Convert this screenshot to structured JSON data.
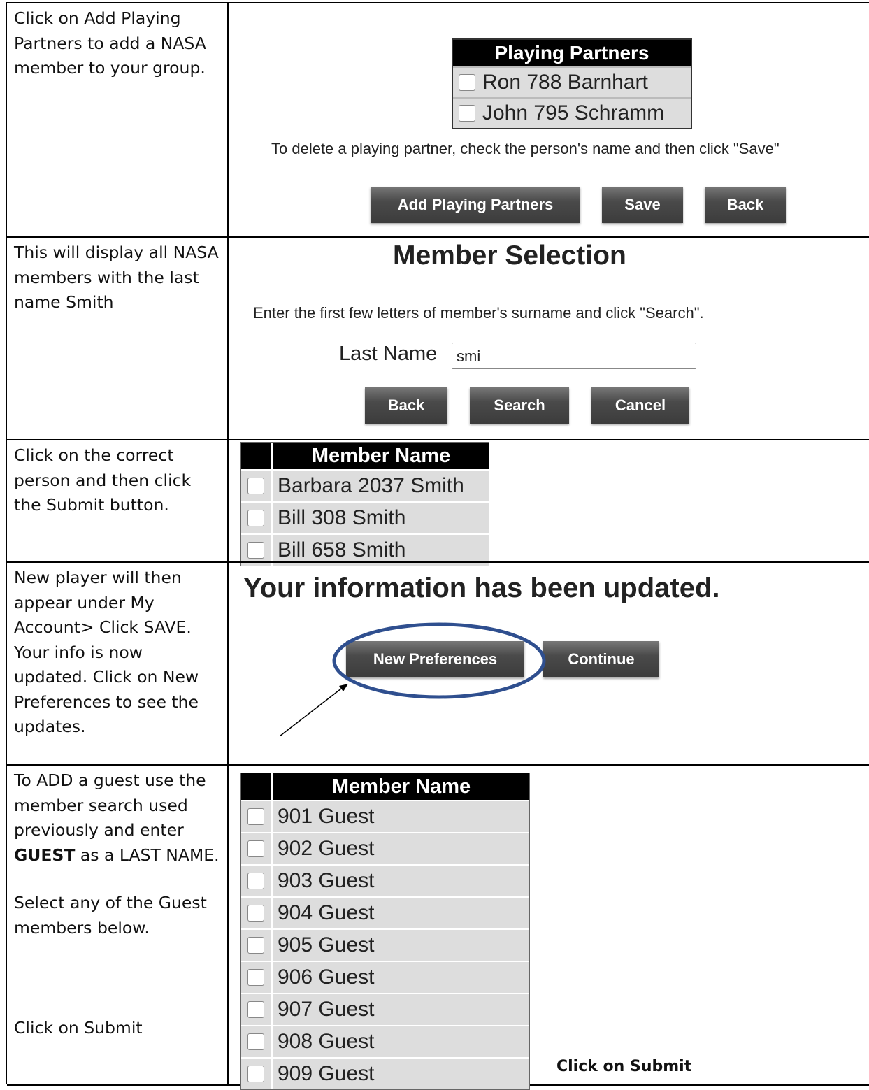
{
  "rows": [
    {
      "instruction": "Click on Add Playing Partners to add a NASA member to your group."
    },
    {
      "instruction": "This will display all NASA members with the last name Smith"
    },
    {
      "instruction": "Click on the correct person and then click the Submit button."
    },
    {
      "instruction": "New player will then appear under My Account> Click SAVE. Your info is now updated.  Click on New Preferences to see the updates."
    },
    {
      "instruction_part1_before": "To ADD a guest use the member search used previously and enter ",
      "instruction_part1_bold": "GUEST",
      "instruction_part1_after": " as a LAST NAME.",
      "instruction_part2": "Select any of the Guest members below.",
      "instruction_part3": "Click on Submit"
    }
  ],
  "playing_partners": {
    "title": "Playing Partners",
    "members": [
      "Ron 788 Barnhart",
      "John 795 Schramm"
    ],
    "delete_hint": "To delete a playing partner, check the person's name and then click \"Save\"",
    "buttons": {
      "add": "Add Playing Partners",
      "save": "Save",
      "back": "Back"
    }
  },
  "member_selection": {
    "title": "Member Selection",
    "hint": "Enter the first few letters of member's surname and click \"Search\".",
    "last_name_label": "Last Name",
    "last_name_value": "smi",
    "buttons": {
      "back": "Back",
      "search": "Search",
      "cancel": "Cancel"
    }
  },
  "smith_results": {
    "header": "Member Name",
    "members": [
      "Barbara 2037 Smith",
      "Bill 308 Smith",
      "Bill 658 Smith"
    ]
  },
  "updated": {
    "message": "Your information has been updated.",
    "buttons": {
      "new_preferences": "New Preferences",
      "continue": "Continue"
    }
  },
  "guest_results": {
    "header": "Member Name",
    "members": [
      "901 Guest",
      "902 Guest",
      "903 Guest",
      "904 Guest",
      "905 Guest",
      "906 Guest",
      "907 Guest",
      "908 Guest",
      "909 Guest"
    ],
    "submit_note": "Click on Submit"
  },
  "colors": {
    "button_grey": "#4a4a4a",
    "header_black": "#000000",
    "row_grey": "#dddddd",
    "highlight_ellipse": "#2f4f8f"
  }
}
